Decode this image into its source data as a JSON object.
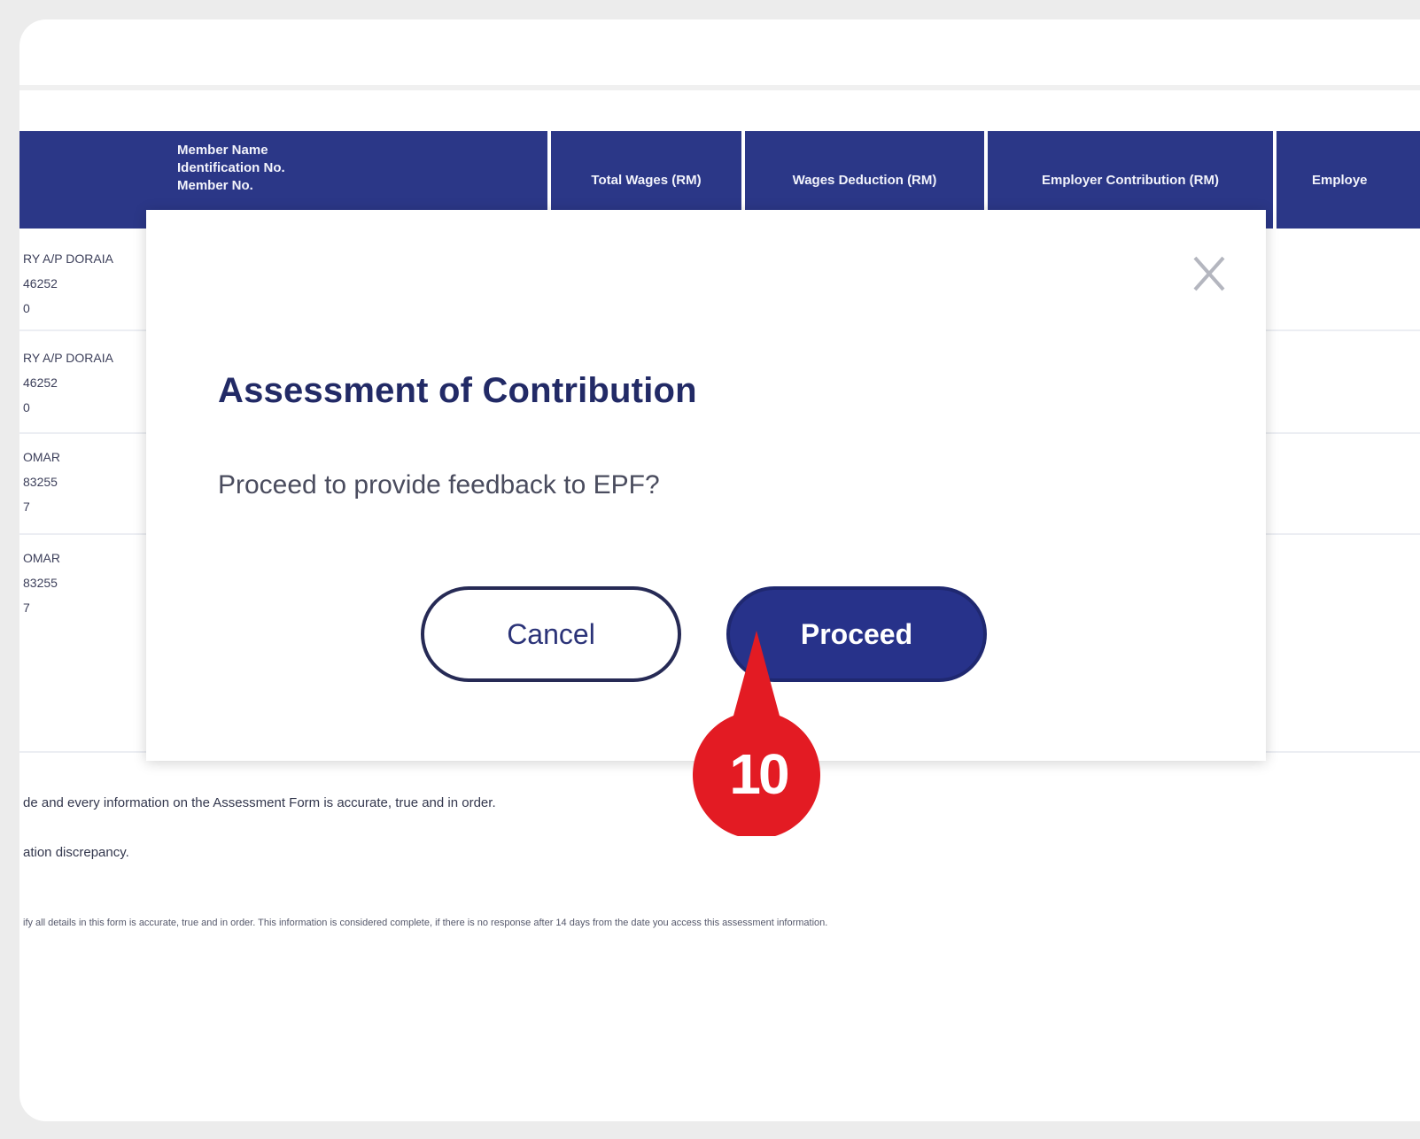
{
  "table": {
    "headers": {
      "member": [
        "Member Name",
        "Identification No.",
        "Member No."
      ],
      "total_wages": "Total Wages (RM)",
      "wages_deduction": "Wages Deduction (RM)",
      "employer_contribution": "Employer Contribution (RM)",
      "employee_contribution": "Employe"
    },
    "rows": [
      [
        "RY A/P DORAIA",
        "46252",
        "0"
      ],
      [
        "RY A/P DORAIA",
        "46252",
        "0"
      ],
      [
        "OMAR",
        "83255",
        "7"
      ],
      [
        "OMAR",
        "83255",
        "7"
      ]
    ]
  },
  "notes": {
    "line1": "de and every information on the Assessment Form is accurate, true and in order.",
    "line2": "ation discrepancy.",
    "line3": "ify all details in this form is accurate, true and in order. This information is considered complete, if there is no response after 14 days from the date you access this assessment information."
  },
  "modal": {
    "title": "Assessment of Contribution",
    "message": "Proceed to provide feedback to EPF?",
    "cancel_label": "Cancel",
    "proceed_label": "Proceed",
    "close_icon": "close-icon"
  },
  "step_marker": {
    "number": "10",
    "color": "#e31b23"
  },
  "colors": {
    "header_bg": "#2b3787",
    "primary": "#27328a",
    "title": "#222a66"
  }
}
